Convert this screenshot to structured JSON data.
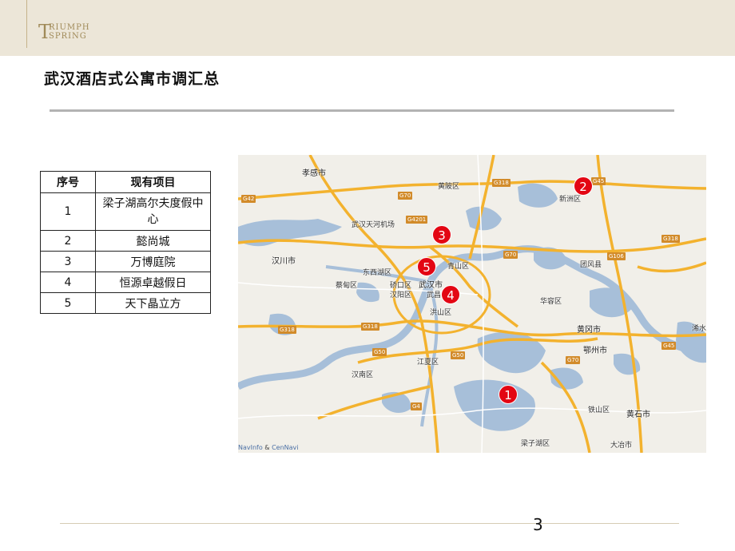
{
  "header": {
    "logo": {
      "big": "T",
      "line1": "RIUMPH",
      "line2": "SPRING"
    }
  },
  "title": "武汉酒店式公寓市调汇总",
  "table": {
    "headers": [
      "序号",
      "现有项目"
    ],
    "rows": [
      {
        "no": "1",
        "name": "梁子湖高尔夫度假中心"
      },
      {
        "no": "2",
        "name": "懿尚城"
      },
      {
        "no": "3",
        "name": "万博庭院"
      },
      {
        "no": "4",
        "name": "恒源卓越假日"
      },
      {
        "no": "5",
        "name": "天下晶立方"
      }
    ]
  },
  "map": {
    "colors": {
      "water": "#a7bfd9",
      "land": "#f1efe9",
      "highway": "#f3b22e",
      "road": "#ffffff",
      "marker": "#e30613"
    },
    "labels": {
      "xiaogan": "孝感市",
      "huangpi": "黄陂区",
      "wuhan_airport": "武汉天河机场",
      "xinzhou": "新洲区",
      "qingshan": "青山区",
      "wuhan": "武汉市",
      "dongxihu": "东西湖区",
      "qiaokou": "硚口区",
      "hanyang": "汉阳区",
      "wuchang": "武昌区",
      "hongshan": "洪山区",
      "caidian": "蔡甸区",
      "hanchuan": "汉川市",
      "tuanfeng": "团风县",
      "huarong": "华容区",
      "huanggang": "黄冈市",
      "ezhou": "鄂州市",
      "xishui": "浠水",
      "jiangxia": "江夏区",
      "hannan": "汉南区",
      "tieshan": "铁山区",
      "huangshi": "黄石市",
      "liangzihu": "梁子湖区",
      "daye": "大冶市"
    },
    "shields": {
      "g70_n": "G70",
      "g318_n": "G318",
      "g45_ne": "G45",
      "g42": "G42",
      "g4201": "G4201",
      "g70_c": "G70",
      "g106": "G106",
      "g318_e": "G318",
      "g318_w": "G318",
      "g318_s": "G318",
      "g50_w": "G50",
      "g50_c": "G50",
      "g70_se": "G70",
      "g45_e": "G45",
      "g4": "G4"
    },
    "markers": [
      "1",
      "2",
      "3",
      "4",
      "5"
    ],
    "credit": {
      "navinfo": "NavInfo",
      "amp": " & ",
      "cennavi": "CenNavi"
    }
  },
  "page_number": "3"
}
